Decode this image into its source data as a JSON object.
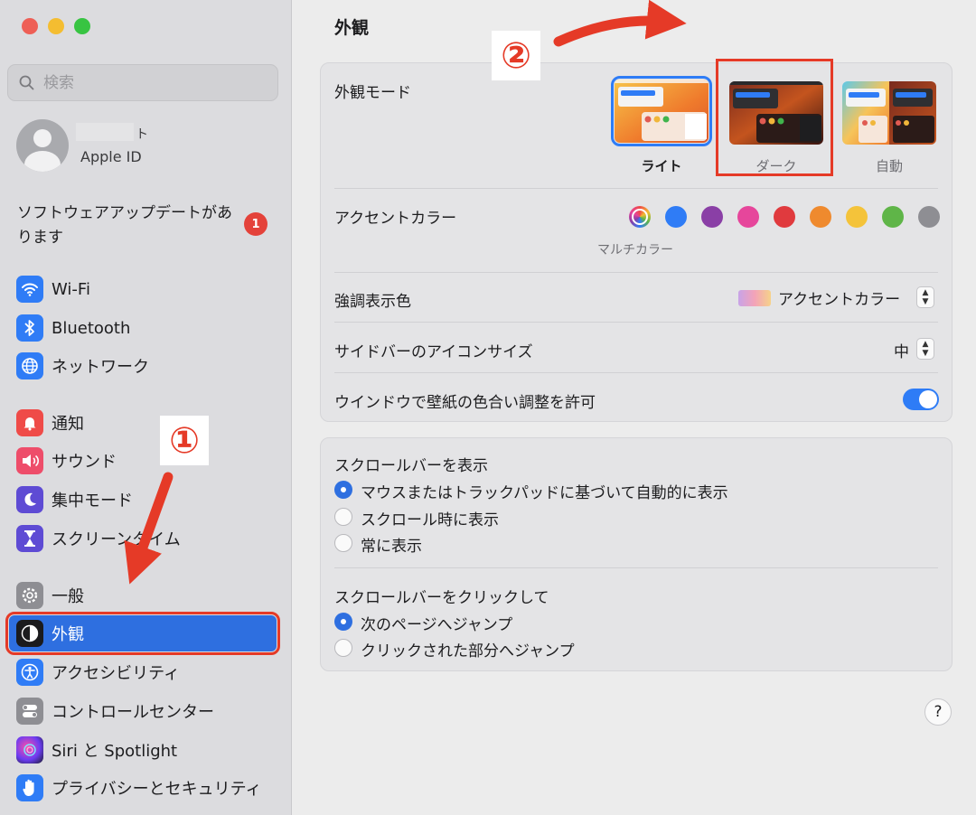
{
  "window": {
    "traffic_lights": [
      "close",
      "minimize",
      "zoom"
    ],
    "colors": {
      "close": "#ee5f56",
      "minimize": "#f4bd31",
      "zoom": "#38c442"
    }
  },
  "sidebar": {
    "search": {
      "placeholder": "検索",
      "value": ""
    },
    "account": {
      "subtitle": "Apple ID",
      "name_hidden": true
    },
    "update": {
      "text": "ソフトウェアアップデートがあります",
      "badge": "1"
    },
    "items": [
      {
        "label": "Wi-Fi",
        "icon": "wifi-icon"
      },
      {
        "label": "Bluetooth",
        "icon": "bluetooth-icon"
      },
      {
        "label": "ネットワーク",
        "icon": "globe-icon"
      },
      {
        "label": "通知",
        "icon": "bell-icon"
      },
      {
        "label": "サウンド",
        "icon": "speaker-icon"
      },
      {
        "label": "集中モード",
        "icon": "moon-icon"
      },
      {
        "label": "スクリーンタイム",
        "icon": "hourglass-icon"
      },
      {
        "label": "一般",
        "icon": "gear-icon"
      },
      {
        "label": "外観",
        "icon": "appearance-icon",
        "active": true
      },
      {
        "label": "アクセシビリティ",
        "icon": "accessibility-icon"
      },
      {
        "label": "コントロールセンター",
        "icon": "toggles-icon"
      },
      {
        "label": "Siri と Spotlight",
        "icon": "siri-icon"
      },
      {
        "label": "プライバシーとセキュリティ",
        "icon": "hand-icon"
      }
    ]
  },
  "main": {
    "title": "外観",
    "appearance_mode": {
      "label": "外観モード",
      "options": [
        {
          "label": "ライト",
          "selected": true
        },
        {
          "label": "ダーク",
          "selected": false
        },
        {
          "label": "自動",
          "selected": false
        }
      ]
    },
    "accent": {
      "label": "アクセントカラー",
      "selected_caption": "マルチカラー",
      "swatches": [
        "multicolor",
        "#2f7cf6",
        "#8a3fa6",
        "#e6469b",
        "#e03a3e",
        "#ef8a2e",
        "#f4c33a",
        "#5fb548",
        "#8e8e93"
      ]
    },
    "highlight": {
      "label": "強調表示色",
      "value": "アクセントカラー"
    },
    "sidebar_icon_size": {
      "label": "サイドバーのアイコンサイズ",
      "value": "中"
    },
    "wallpaper_tint": {
      "label": "ウインドウで壁紙の色合い調整を許可",
      "on": true
    },
    "scrollbars": {
      "label": "スクロールバーを表示",
      "options": [
        {
          "label": "マウスまたはトラックパッドに基づいて自動的に表示",
          "selected": true
        },
        {
          "label": "スクロール時に表示",
          "selected": false
        },
        {
          "label": "常に表示",
          "selected": false
        }
      ]
    },
    "scroll_click": {
      "label": "スクロールバーをクリックして",
      "options": [
        {
          "label": "次のページへジャンプ",
          "selected": true
        },
        {
          "label": "クリックされた部分へジャンプ",
          "selected": false
        }
      ]
    },
    "help": "?"
  },
  "annotations": {
    "step1": "①",
    "step2": "②",
    "color": "#e53a27"
  }
}
